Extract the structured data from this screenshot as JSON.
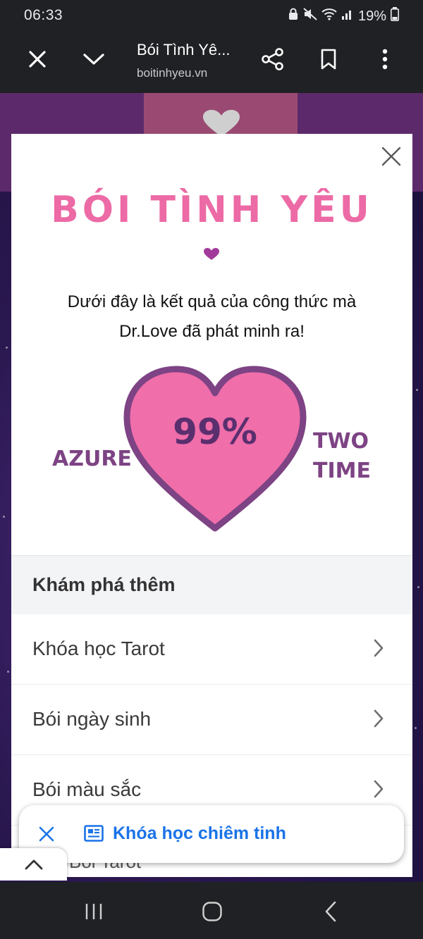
{
  "status_bar": {
    "time": "06:33",
    "battery": "19%"
  },
  "browser": {
    "title": "Bói Tình Yê...",
    "url": "boitinhyeu.vn",
    "icons": [
      "close-icon",
      "chevron-down-icon",
      "share-icon",
      "bookmark-icon",
      "more-vert-icon"
    ]
  },
  "modal": {
    "title": "BÓI TÌNH YÊU",
    "description_line1": "Dưới đây là kết quả của công thức mà",
    "description_line2": "Dr.Love đã phát minh ra!",
    "result_percent": "99%",
    "name_left": "AZURE",
    "name_right_line1": "TWO",
    "name_right_line2": "TIME",
    "explore": {
      "header": "Khám phá thêm",
      "items": [
        {
          "label": "Khóa học Tarot"
        },
        {
          "label": "Bói ngày sinh"
        },
        {
          "label": "Bói màu sắc"
        }
      ],
      "partial_item": "Bói Tarot"
    }
  },
  "floating_chip": {
    "label": "Khóa học chiêm tinh"
  },
  "colors": {
    "title_pink": "#ec6aa5",
    "heart_fill": "#f06eaa",
    "heart_stroke": "#7d4384",
    "names_purple": "#7d4384",
    "link_blue": "#1a73e8"
  }
}
